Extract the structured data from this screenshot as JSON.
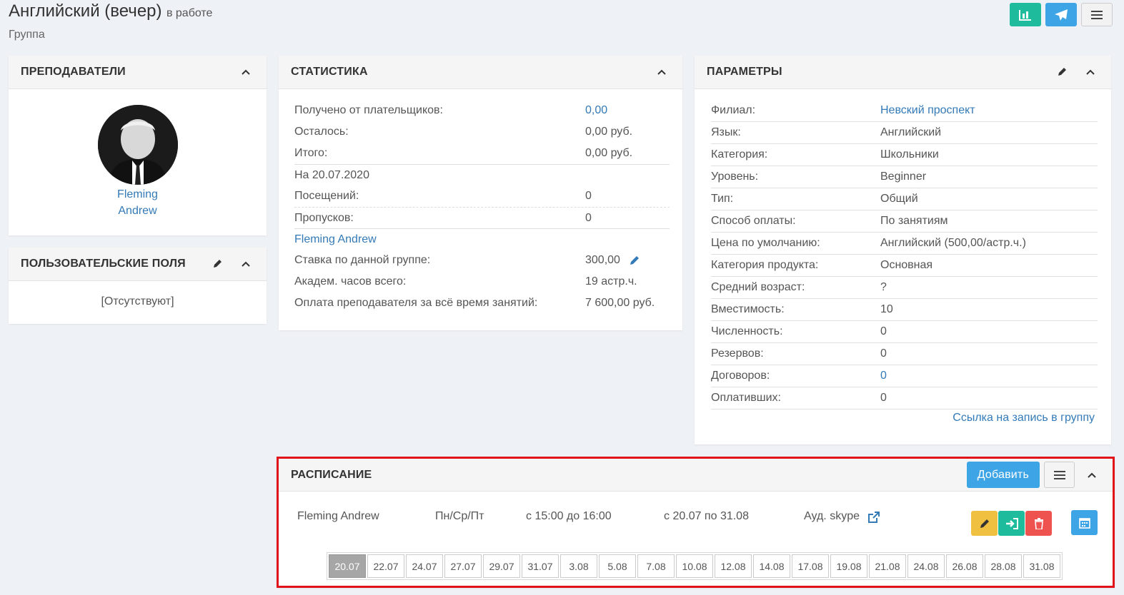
{
  "header": {
    "title": "Английский (вечер)",
    "status": "в работе",
    "subtitle": "Группа"
  },
  "top_actions": [
    {
      "icon": "bar-chart-icon",
      "color": "#1ebc9c"
    },
    {
      "icon": "paper-plane-icon",
      "color": "#3da4e6"
    },
    {
      "icon": "hamburger-menu-icon",
      "color": "#f2f2f2"
    }
  ],
  "teachers": {
    "title": "ПРЕПОДАВАТЕЛИ",
    "name_first": "Fleming",
    "name_last": "Andrew"
  },
  "custom_fields": {
    "title": "ПОЛЬЗОВАТЕЛЬСКИЕ ПОЛЯ",
    "empty": "[Отсутствуют]"
  },
  "stats": {
    "title": "СТАТИСТИКА",
    "received_label": "Получено от плательщиков:",
    "received_value": "0,00",
    "remaining_label": "Осталось:",
    "remaining_value": "0,00 руб.",
    "total_label": "Итого:",
    "total_value": "0,00 руб.",
    "as_of": "На 20.07.2020",
    "visits_label": "Посещений:",
    "visits_value": "0",
    "absences_label": "Пропусков:",
    "absences_value": "0",
    "teacher_link": "Fleming Andrew",
    "rate_label": "Ставка по данной группе:",
    "rate_value": "300,00",
    "hours_label": "Академ. часов всего:",
    "hours_value": "19 астр.ч.",
    "payment_label": "Оплата преподавателя за всё время занятий:",
    "payment_value": "7 600,00 руб."
  },
  "params": {
    "title": "ПАРАМЕТРЫ",
    "rows": [
      {
        "k": "Филиал:",
        "v": "Невский проспект",
        "link": true
      },
      {
        "k": "Язык:",
        "v": "Английский",
        "link": false
      },
      {
        "k": "Категория:",
        "v": "Школьники",
        "link": false
      },
      {
        "k": "Уровень:",
        "v": "Beginner",
        "link": false
      },
      {
        "k": "Тип:",
        "v": "Общий",
        "link": false
      },
      {
        "k": "Способ оплаты:",
        "v": "По занятиям",
        "link": false
      },
      {
        "k": "Цена по умолчанию:",
        "v": "Английский (500,00/астр.ч.)",
        "link": false
      },
      {
        "k": "Категория продукта:",
        "v": "Основная",
        "link": false
      },
      {
        "k": "Средний возраст:",
        "v": "?",
        "link": false
      },
      {
        "k": "Вместимость:",
        "v": "10",
        "link": false
      },
      {
        "k": "Численность:",
        "v": "0",
        "link": false
      },
      {
        "k": "Резервов:",
        "v": "0",
        "link": false
      },
      {
        "k": "Договоров:",
        "v": "0",
        "link": true
      },
      {
        "k": "Оплативших:",
        "v": "0",
        "link": false
      }
    ],
    "signup_link": "Ссылка на запись в группу"
  },
  "schedule": {
    "title": "РАСПИСАНИЕ",
    "add_label": "Добавить",
    "teacher": "Fleming Andrew",
    "days": "Пн/Ср/Пт",
    "time": "с 15:00 до 16:00",
    "period": "с 20.07 по 31.08",
    "room": "Ауд. skype",
    "dates": [
      "20.07",
      "22.07",
      "24.07",
      "27.07",
      "29.07",
      "31.07",
      "3.08",
      "5.08",
      "7.08",
      "10.08",
      "12.08",
      "14.08",
      "17.08",
      "19.08",
      "21.08",
      "24.08",
      "26.08",
      "28.08",
      "31.08"
    ],
    "active_date": "20.07",
    "colors": {
      "edit": "#f0c040",
      "enter": "#1ebc9c",
      "delete": "#ef5350",
      "calendar": "#3da4e6",
      "border": "#e0131b"
    }
  }
}
